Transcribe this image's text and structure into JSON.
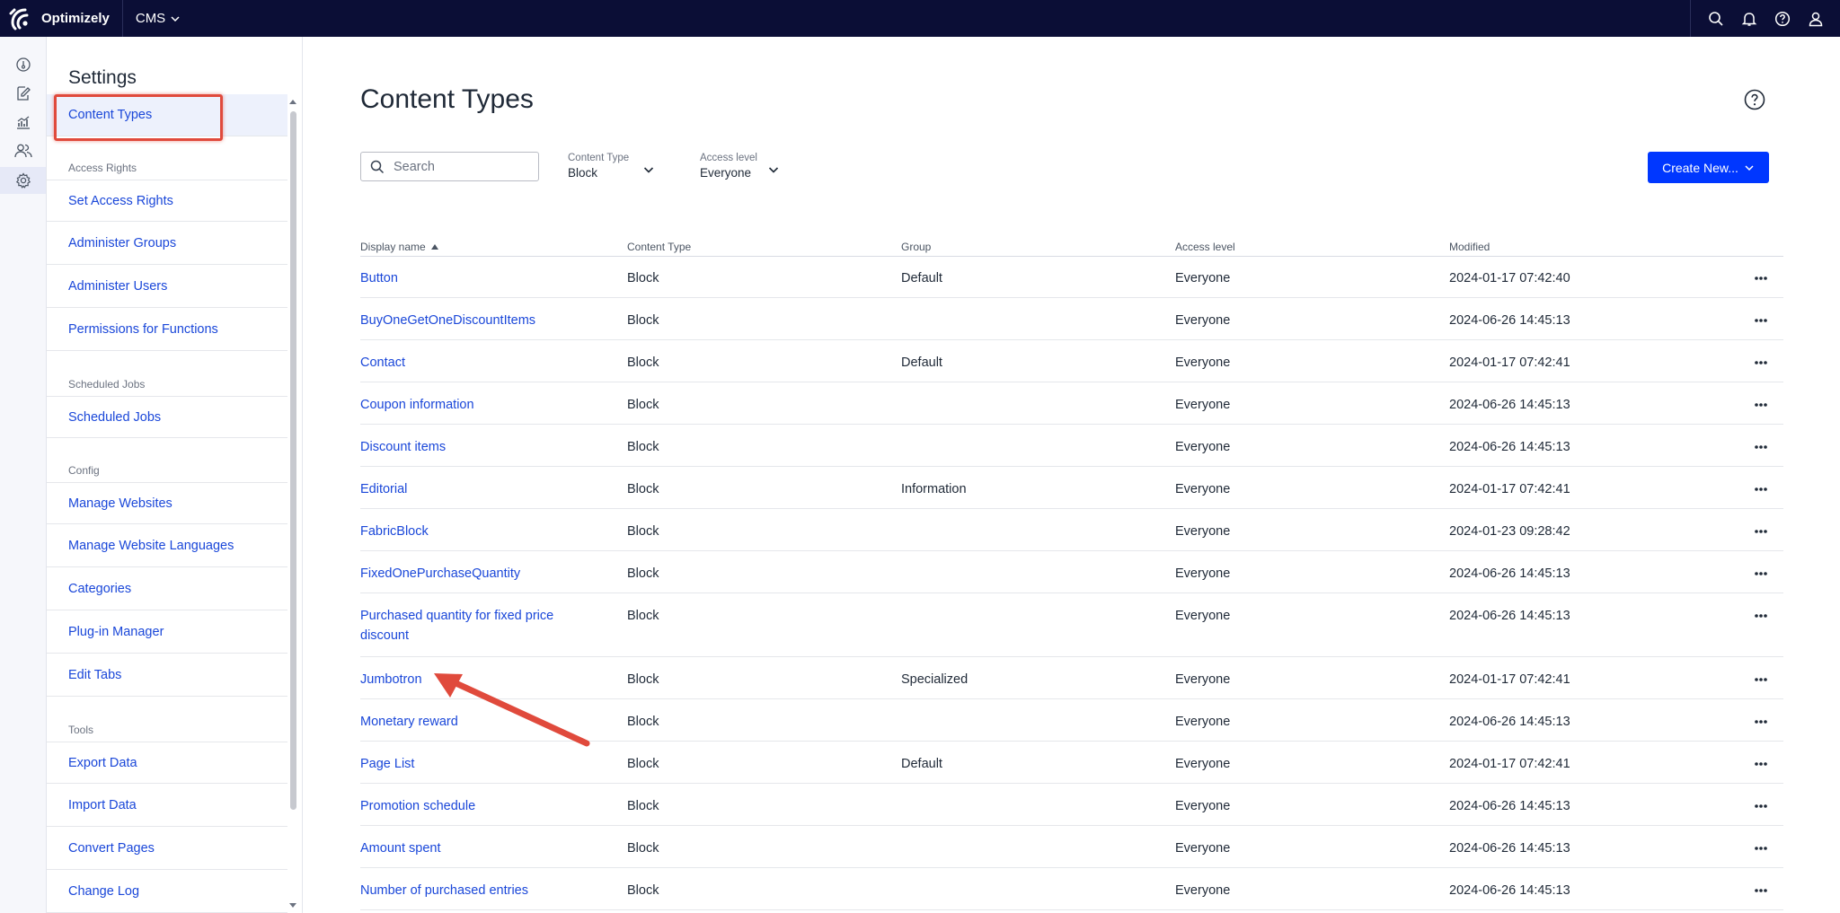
{
  "topbar": {
    "brand": "Optimizely",
    "product": "CMS"
  },
  "sidebar": {
    "title": "Settings",
    "groups": [
      {
        "header": "",
        "items": [
          "Content Types"
        ]
      },
      {
        "header": "Access Rights",
        "items": [
          "Set Access Rights",
          "Administer Groups",
          "Administer Users",
          "Permissions for Functions"
        ]
      },
      {
        "header": "Scheduled Jobs",
        "items": [
          "Scheduled Jobs"
        ]
      },
      {
        "header": "Config",
        "items": [
          "Manage Websites",
          "Manage Website Languages",
          "Categories",
          "Plug-in Manager",
          "Edit Tabs"
        ]
      },
      {
        "header": "Tools",
        "items": [
          "Export Data",
          "Import Data",
          "Convert Pages",
          "Change Log"
        ]
      }
    ]
  },
  "main": {
    "title": "Content Types",
    "search": {
      "placeholder": "Search",
      "value": ""
    },
    "filters": [
      {
        "label": "Content Type",
        "value": "Block"
      },
      {
        "label": "Access level",
        "value": "Everyone"
      }
    ],
    "create_label": "Create New...",
    "columns": [
      "Display name",
      "Content Type",
      "Group",
      "Access level",
      "Modified"
    ],
    "rows": [
      {
        "name": "Button",
        "type": "Block",
        "group": "Default",
        "access": "Everyone",
        "modified": "2024-01-17 07:42:40"
      },
      {
        "name": "BuyOneGetOneDiscountItems",
        "type": "Block",
        "group": "",
        "access": "Everyone",
        "modified": "2024-06-26 14:45:13"
      },
      {
        "name": "Contact",
        "type": "Block",
        "group": "Default",
        "access": "Everyone",
        "modified": "2024-01-17 07:42:41"
      },
      {
        "name": "Coupon information",
        "type": "Block",
        "group": "",
        "access": "Everyone",
        "modified": "2024-06-26 14:45:13"
      },
      {
        "name": "Discount items",
        "type": "Block",
        "group": "",
        "access": "Everyone",
        "modified": "2024-06-26 14:45:13"
      },
      {
        "name": "Editorial",
        "type": "Block",
        "group": "Information",
        "access": "Everyone",
        "modified": "2024-01-17 07:42:41"
      },
      {
        "name": "FabricBlock",
        "type": "Block",
        "group": "",
        "access": "Everyone",
        "modified": "2024-01-23 09:28:42"
      },
      {
        "name": "FixedOnePurchaseQuantity",
        "type": "Block",
        "group": "",
        "access": "Everyone",
        "modified": "2024-06-26 14:45:13"
      },
      {
        "name": "Purchased quantity for fixed price discount",
        "type": "Block",
        "group": "",
        "access": "Everyone",
        "modified": "2024-06-26 14:45:13"
      },
      {
        "name": "Jumbotron",
        "type": "Block",
        "group": "Specialized",
        "access": "Everyone",
        "modified": "2024-01-17 07:42:41"
      },
      {
        "name": "Monetary reward",
        "type": "Block",
        "group": "",
        "access": "Everyone",
        "modified": "2024-06-26 14:45:13"
      },
      {
        "name": "Page List",
        "type": "Block",
        "group": "Default",
        "access": "Everyone",
        "modified": "2024-01-17 07:42:41"
      },
      {
        "name": "Promotion schedule",
        "type": "Block",
        "group": "",
        "access": "Everyone",
        "modified": "2024-06-26 14:45:13"
      },
      {
        "name": "Amount spent",
        "type": "Block",
        "group": "",
        "access": "Everyone",
        "modified": "2024-06-26 14:45:13"
      },
      {
        "name": "Number of purchased entries",
        "type": "Block",
        "group": "",
        "access": "Everyone",
        "modified": "2024-06-26 14:45:13"
      }
    ]
  },
  "icons": {
    "rail": [
      "dashboard-icon",
      "edit-icon",
      "reports-icon",
      "users-icon",
      "settings-icon"
    ],
    "topbar": [
      "search-icon",
      "bell-icon",
      "help-icon",
      "user-icon"
    ]
  },
  "colors": {
    "topbar": "#0b0e36",
    "link": "#1a47d9",
    "primary": "#0037ff",
    "highlight": "#e04a3c"
  }
}
